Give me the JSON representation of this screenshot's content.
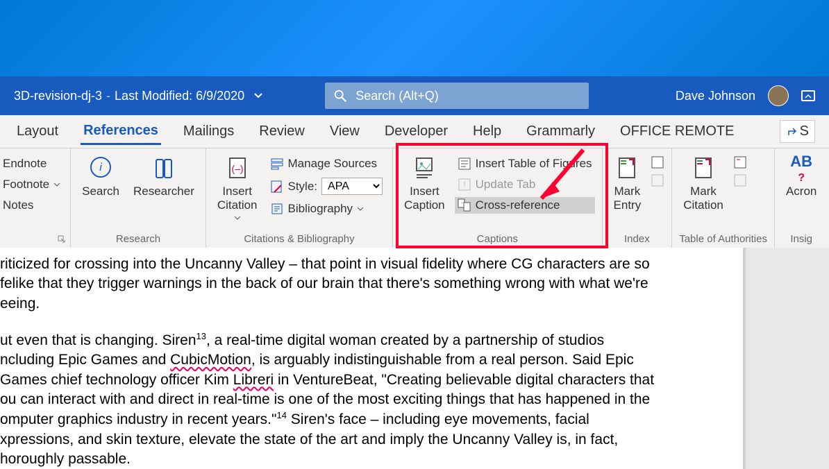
{
  "titlebar": {
    "filename": "3D-revision-dj-3",
    "modified": "Last Modified: 6/9/2020",
    "search_placeholder": "Search (Alt+Q)",
    "username": "Dave Johnson"
  },
  "tabs": {
    "items": [
      {
        "label": "Layout"
      },
      {
        "label": "References"
      },
      {
        "label": "Mailings"
      },
      {
        "label": "Review"
      },
      {
        "label": "View"
      },
      {
        "label": "Developer"
      },
      {
        "label": "Help"
      },
      {
        "label": "Grammarly"
      },
      {
        "label": "OFFICE REMOTE"
      }
    ],
    "share": "S"
  },
  "ribbon": {
    "footnotes": {
      "endnote": "Endnote",
      "footnote": "Footnote",
      "notes": "Notes"
    },
    "research": {
      "search": "Search",
      "researcher": "Researcher",
      "group": "Research"
    },
    "citations": {
      "insert_citation": "Insert\nCitation",
      "manage_sources": "Manage Sources",
      "style_label": "Style:",
      "style_value": "APA",
      "bibliography": "Bibliography",
      "group": "Citations & Bibliography"
    },
    "captions": {
      "insert_caption": "Insert\nCaption",
      "insert_table_figures": "Insert Table of Figures",
      "update_table": "Update Tab",
      "cross_reference": "Cross-reference",
      "group": "Captions"
    },
    "index": {
      "mark_entry": "Mark\nEntry",
      "group": "Index"
    },
    "authorities": {
      "mark_citation": "Mark\nCitation",
      "group": "Table of Authorities"
    },
    "abbrev": {
      "ab": "AB",
      "acron": "Acron",
      "group": "Insig"
    }
  },
  "document": {
    "p1a": "riticized for crossing into the Uncanny Valley – that point in visual fidelity where CG characters are so",
    "p1b": "felike that they trigger warnings in the back of our brain that there's something wrong with what we're",
    "p1c": "eeing.",
    "p2a": "ut even that is changing. Siren",
    "p2a_sup": "13",
    "p2a2": ", a real-time digital woman created by a partnership of studios",
    "p2b": "ncluding Epic Games and ",
    "p2b_wavy": "CubicMotion",
    "p2b2": ", is arguably indistinguishable from a real person. Said Epic",
    "p2c": "Games chief technology officer Kim ",
    "p2c_wavy": "Libreri",
    "p2c2": " in VentureBeat, \"Creating believable digital characters that",
    "p2d": "ou can interact with and direct in real-time is one of the most exciting things that has happened in the",
    "p2e": "omputer graphics industry in recent years.\"",
    "p2e_sup": "14",
    "p2e2": " Siren's face – including eye movements, facial",
    "p2f": "xpressions, and skin texture, elevate the state of the art and imply the Uncanny Valley is, in fact,",
    "p2g": "horoughly passable."
  }
}
